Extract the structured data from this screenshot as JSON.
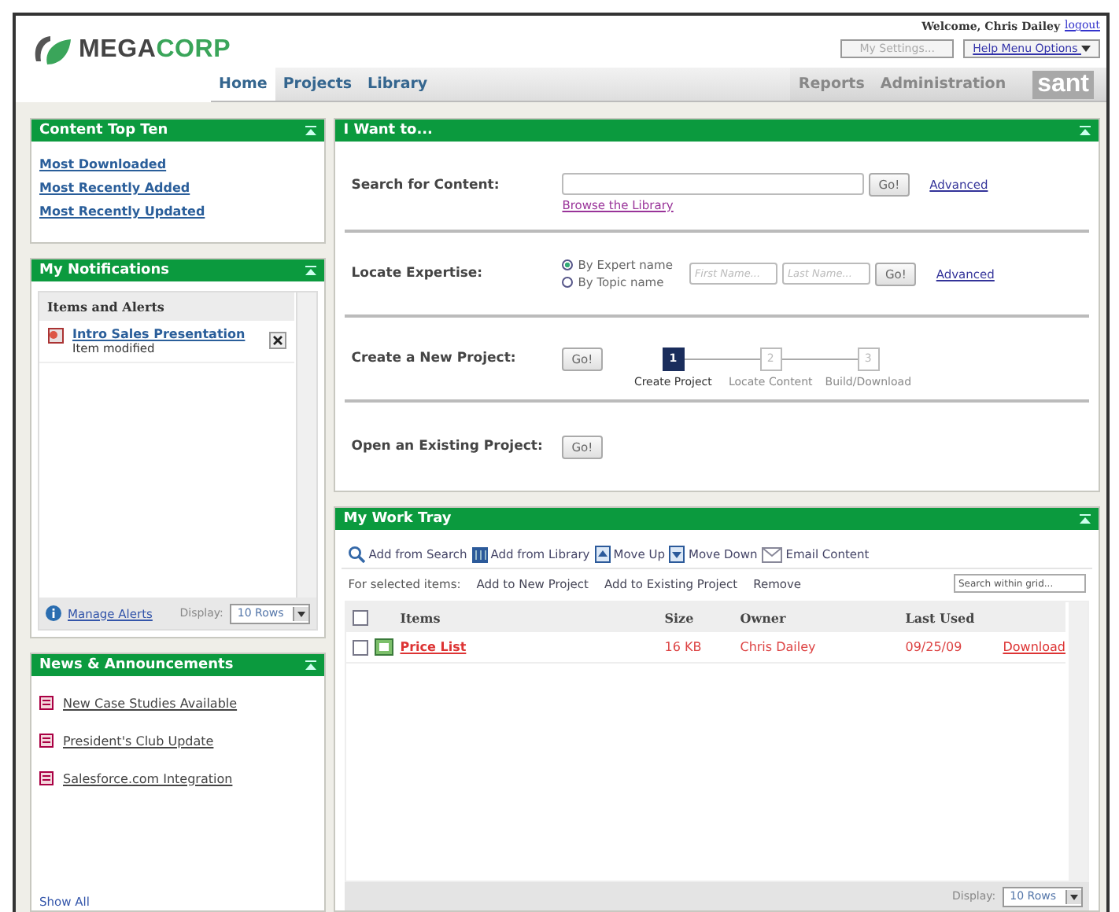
{
  "header": {
    "logo_a": "MEGA",
    "logo_b": "CORP",
    "welcome": "Welcome, Chris Dailey",
    "logout": "logout",
    "settings_button": {
      "label": "My Settings...",
      "disabled": true
    },
    "help_menu": "Help Menu Options"
  },
  "nav": {
    "left": [
      {
        "label": "Home",
        "selected": true
      },
      {
        "label": "Projects",
        "selected": false
      },
      {
        "label": "Library",
        "selected": false
      }
    ],
    "right": [
      "Reports",
      "Administration"
    ],
    "brand": "sant"
  },
  "top_ten": {
    "title": "Content Top Ten",
    "links": [
      "Most Downloaded",
      "Most Recently Added",
      "Most Recently Updated"
    ]
  },
  "notifications": {
    "title": "My Notifications",
    "list_header": "Items and Alerts",
    "items": [
      {
        "title": "Intro Sales Presentation",
        "subtitle": "Item modified"
      }
    ],
    "footer_link": "Manage Alerts",
    "display_label": "Display:",
    "display_value": "10 Rows"
  },
  "news": {
    "title": "News & Announcements",
    "items": [
      "New Case Studies Available",
      "President's Club Update",
      "Salesforce.com Integration"
    ],
    "show_all": "Show All"
  },
  "i_want_to": {
    "title": "I Want to...",
    "search": {
      "label": "Search for Content:",
      "button": "Go!",
      "advanced": "Advanced",
      "browse": "Browse the Library"
    },
    "expertise": {
      "label": "Locate Expertise:",
      "options": [
        {
          "label": "By Expert name",
          "selected": true
        },
        {
          "label": "By Topic name",
          "selected": false
        }
      ],
      "first_placeholder": "First Name...",
      "last_placeholder": "Last Name...",
      "button": "Go!",
      "advanced": "Advanced"
    },
    "new_project": {
      "label": "Create a New Project:",
      "button": "Go!",
      "steps": [
        {
          "number": "1",
          "label": "Create Project",
          "selected": true
        },
        {
          "number": "2",
          "label": "Locate Content",
          "selected": false
        },
        {
          "number": "3",
          "label": "Build/Download",
          "selected": false
        }
      ]
    },
    "existing": {
      "label": "Open an Existing Project:",
      "button": "Go!"
    }
  },
  "work_tray": {
    "title": "My Work Tray",
    "toolbar": [
      {
        "kind": "search",
        "label": "Add from Search"
      },
      {
        "kind": "library",
        "label": "Add from Library"
      },
      {
        "kind": "up",
        "label": "Move Up"
      },
      {
        "kind": "down",
        "label": "Move Down"
      },
      {
        "kind": "email",
        "label": "Email Content"
      }
    ],
    "selected_label": "For selected items:",
    "actions": [
      "Add to New Project",
      "Add to Existing Project",
      "Remove"
    ],
    "grid_search_placeholder": "Search within grid...",
    "select_all_checked": false,
    "columns": [
      "Items",
      "Size",
      "Owner",
      "Last Used"
    ],
    "rows": [
      {
        "checked": false,
        "item": "Price List",
        "size": "16 KB",
        "owner": "Chris Dailey",
        "last_used": "09/25/09",
        "action": "Download"
      }
    ],
    "display_label": "Display:",
    "display_value": "10 Rows"
  }
}
